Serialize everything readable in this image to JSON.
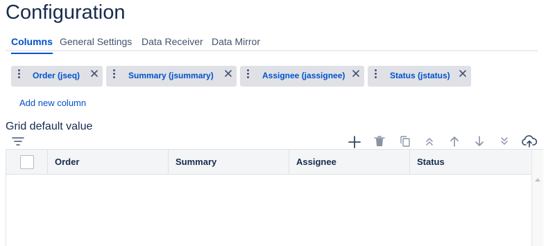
{
  "page": {
    "title": "Configuration"
  },
  "tabs": [
    {
      "label": "Columns",
      "active": true
    },
    {
      "label": "General Settings",
      "active": false
    },
    {
      "label": "Data Receiver",
      "active": false
    },
    {
      "label": "Data Mirror",
      "active": false
    }
  ],
  "column_chips": [
    {
      "label": "Order (jseq)",
      "handle_icon": "drag-handle-icon",
      "remove_icon": "close-icon"
    },
    {
      "label": "Summary (jsummary)",
      "handle_icon": "drag-handle-icon",
      "remove_icon": "close-icon"
    },
    {
      "label": "Assignee (jassignee)",
      "handle_icon": "drag-handle-icon",
      "remove_icon": "close-icon"
    },
    {
      "label": "Status (jstatus)",
      "handle_icon": "drag-handle-icon",
      "remove_icon": "close-icon"
    }
  ],
  "add_column_link": "Add new column",
  "grid_section": {
    "label": "Grid default value",
    "toolbar": {
      "filter_icon": "filter-icon",
      "add_icon": "plus-icon",
      "delete_icon": "trash-icon",
      "copy_icon": "copy-icon",
      "move_top_icon": "double-chevron-up-icon",
      "move_up_icon": "arrow-up-icon",
      "move_down_icon": "arrow-down-icon",
      "move_bottom_icon": "double-chevron-down-icon",
      "upload_icon": "cloud-upload-icon"
    },
    "columns": [
      "Order",
      "Summary",
      "Assignee",
      "Status"
    ],
    "rows": []
  },
  "colors": {
    "accent": "#0052cc",
    "text": "#172b4d",
    "chip_bg": "#dfe1e6",
    "header_bg": "#f4f5f7",
    "icon": "#42526e"
  }
}
